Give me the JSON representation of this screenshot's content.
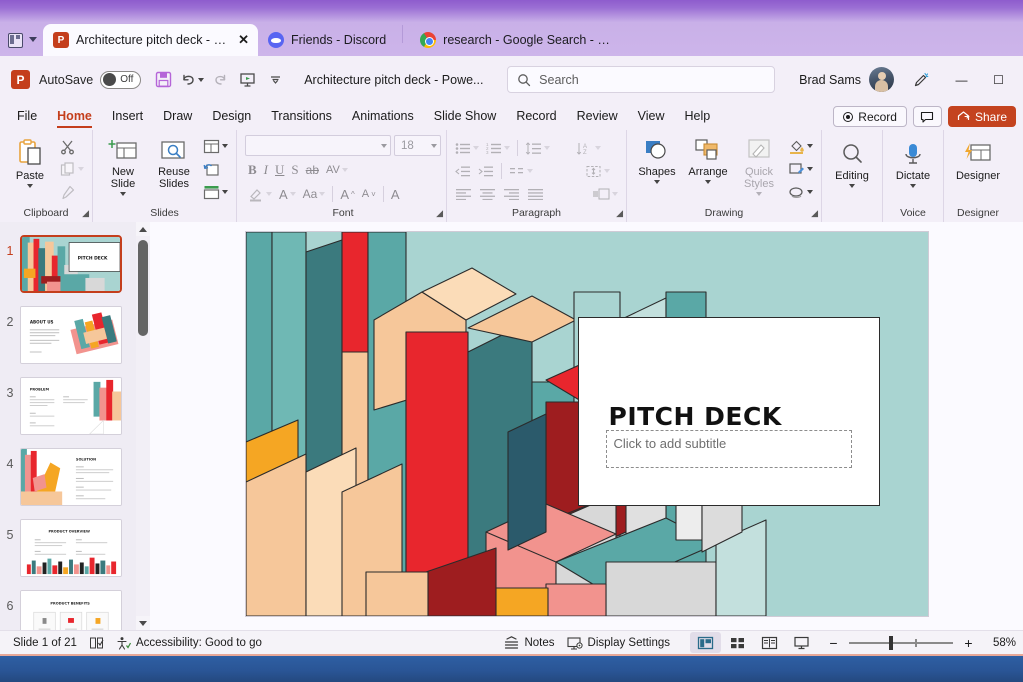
{
  "tabstrip": {
    "tabs": [
      {
        "title": "Architecture pitch deck - Po...",
        "favicon": "powerpoint-icon",
        "active": true,
        "close_label": "✕"
      },
      {
        "title": "Friends - Discord",
        "favicon": "discord-icon",
        "active": false
      },
      {
        "title": "research - Google Search - Goo...",
        "favicon": "chrome-icon",
        "active": false
      }
    ]
  },
  "titlebar": {
    "autosave_label": "AutoSave",
    "autosave_state": "Off",
    "quick_access": [
      {
        "name": "save-icon",
        "tooltip": "Save"
      },
      {
        "name": "undo-icon",
        "tooltip": "Undo"
      },
      {
        "name": "redo-icon",
        "tooltip": "Redo"
      },
      {
        "name": "start-presentation-icon",
        "tooltip": "Start From Beginning"
      },
      {
        "name": "customize-quick-access-icon",
        "tooltip": "Customize Quick Access Toolbar"
      }
    ],
    "document_title": "Architecture pitch deck  -  Powe...",
    "search_placeholder": "Search",
    "user_name": "Brad Sams",
    "window_controls": {
      "minimize": "—",
      "maximize": "☐"
    }
  },
  "ribbon": {
    "tabs": [
      {
        "label": "File",
        "active": false
      },
      {
        "label": "Home",
        "active": true
      },
      {
        "label": "Insert",
        "active": false
      },
      {
        "label": "Draw",
        "active": false
      },
      {
        "label": "Design",
        "active": false
      },
      {
        "label": "Transitions",
        "active": false
      },
      {
        "label": "Animations",
        "active": false
      },
      {
        "label": "Slide Show",
        "active": false
      },
      {
        "label": "Record",
        "active": false
      },
      {
        "label": "Review",
        "active": false
      },
      {
        "label": "View",
        "active": false
      },
      {
        "label": "Help",
        "active": false
      }
    ],
    "record_button": "Record",
    "share_button": "Share",
    "groups": {
      "clipboard": {
        "label": "Clipboard",
        "paste": "Paste",
        "cut": "Cut",
        "copy": "Copy",
        "format_painter": "Format Painter"
      },
      "slides": {
        "label": "Slides",
        "new_slide": "New Slide",
        "reuse_slides": "Reuse Slides",
        "layout": "Layout",
        "reset": "Reset",
        "section": "Section"
      },
      "font": {
        "label": "Font",
        "font_name": "",
        "font_size": "18",
        "bold": "B",
        "italic": "I",
        "underline": "U",
        "shadow": "S",
        "strikethrough": "ab",
        "char_spacing": "AV",
        "text_highlight": "Text Highlight Color",
        "font_color": "A",
        "change_case": "Aa",
        "increase_size": "A",
        "decrease_size": "A",
        "clear_formatting": "A"
      },
      "paragraph": {
        "label": "Paragraph",
        "bullets": "Bullets",
        "numbering": "Numbering",
        "line_spacing": "Line Spacing",
        "text_direction": "Text Direction",
        "decrease_indent": "Decrease Indent",
        "increase_indent": "Increase Indent",
        "align_left": "Align Left",
        "align_center": "Center",
        "align_right": "Align Right",
        "justify": "Justify",
        "columns": "Columns",
        "align_text": "Align Text",
        "smartart": "Convert to SmartArt"
      },
      "drawing": {
        "label": "Drawing",
        "shapes": "Shapes",
        "arrange": "Arrange",
        "quick_styles": "Quick Styles",
        "shape_fill": "Shape Fill",
        "shape_outline": "Shape Outline",
        "shape_effects": "Shape Effects"
      },
      "editing": {
        "label": "",
        "editing": "Editing"
      },
      "voice": {
        "label": "Voice",
        "dictate": "Dictate"
      },
      "designer": {
        "label": "Designer",
        "designer": "Designer"
      }
    }
  },
  "thumbnails": [
    {
      "number": "1",
      "title": "PITCH DECK",
      "selected": true
    },
    {
      "number": "2",
      "title": "ABOUT US",
      "selected": false
    },
    {
      "number": "3",
      "title": "PROBLEM",
      "selected": false
    },
    {
      "number": "4",
      "title": "SOLUTION",
      "selected": false
    },
    {
      "number": "5",
      "title": "PRODUCT OVERVIEW",
      "selected": false
    },
    {
      "number": "6",
      "title": "PRODUCT BENEFITS",
      "selected": false
    }
  ],
  "slide": {
    "title": "PITCH DECK",
    "subtitle_placeholder": "Click to add subtitle",
    "background_color": "#a9d4d1",
    "accent_colors": [
      "#e8262d",
      "#5aa8a6",
      "#f6c79a",
      "#f5a623",
      "#f2938e",
      "#3b7a7e",
      "#9e1d1f"
    ]
  },
  "status": {
    "slide_indicator": "Slide 1 of 21",
    "language_icon": "spell-check-icon",
    "accessibility": "Accessibility: Good to go",
    "notes": "Notes",
    "display_settings": "Display Settings",
    "views": [
      {
        "name": "normal-view",
        "active": true
      },
      {
        "name": "slide-sorter-view",
        "active": false
      },
      {
        "name": "reading-view",
        "active": false
      },
      {
        "name": "slide-show-view",
        "active": false
      }
    ],
    "zoom_out": "−",
    "zoom_in": "+",
    "zoom_level": "58%"
  }
}
